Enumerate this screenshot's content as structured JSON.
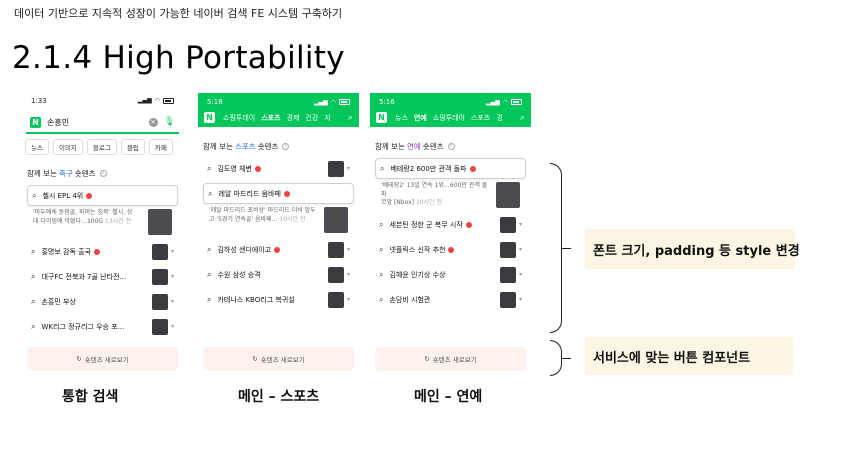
{
  "slide": {
    "header": "데이터 기반으로 지속적 성장이 가능한 네이버 검색 FE 시스템 구축하기",
    "title": "2.1.4 High Portability"
  },
  "colors": {
    "naver_green": "#03c75a",
    "sport_blue": "#1a73e8",
    "ent_purple": "#a23bc4",
    "note_bg": "#fdf5e4",
    "button_bg": "#fdf1ee"
  },
  "phone1": {
    "time": "1:33",
    "query": "손흥민",
    "tabs": [
      "뉴스",
      "이미지",
      "블로그",
      "클립",
      "카페"
    ],
    "section_prefix": "함께 보는 ",
    "section_highlight": "축구",
    "section_suffix": " 숏텐츠",
    "items": [
      "첼시 EPL 4위",
      "홍명보 감독 출국",
      "대구FC 전북과 7골 난타전...",
      "손흥민 부상",
      "WK리그 정규리그 우승 포..."
    ],
    "snippet_line1": "'마두에케 동점골, 파머는 침묵' 첼시, 상",
    "snippet_line2": "대 다이빙에 막혔다…100G",
    "snippet_ago": "13시간 전",
    "more_label": "숏텐츠 새로보기"
  },
  "phone2": {
    "time": "5:18",
    "nav": [
      "쇼핑투데이",
      "스포츠",
      "경제",
      "건강",
      "지"
    ],
    "section_prefix": "함께 보는 ",
    "section_highlight": "스포츠",
    "section_suffix": " 숏텐츠",
    "items": [
      "김도영 체변",
      "레알 마드리드 음바페",
      "김하성 샌디에이고",
      "수원 삼성 승격",
      "카테나스 KBO리그 복귀설"
    ],
    "snippet_line1": "'레알 마드리드 초비상' 마드리드 더비 앞두",
    "snippet_line2": "고 '5경기 연속골' 음바페…",
    "snippet_ago": "10시간 전",
    "more_label": "숏텐츠 새로보기"
  },
  "phone3": {
    "time": "5:16",
    "nav": [
      "뉴스",
      "연예",
      "쇼핑투데이",
      "스포츠",
      "경"
    ],
    "section_prefix": "함께 보는 ",
    "section_highlight": "연예",
    "section_suffix": " 숏텐츠",
    "items": [
      "베테랑2 600만 관객 돌파",
      "세븐틴 정한 군 복무 시작",
      "넷플릭스 신작 추천",
      "김혜윤 인기상 수상",
      "손담비 시험관"
    ],
    "snippet_line1": "'베테랑2' 13일 연속 1위…600만 관객 돌파",
    "snippet_line2": "코앞 [Nbox]",
    "snippet_ago": "10시간 전",
    "more_label": "숏텐츠 새로보기"
  },
  "captions": [
    "통합 검색",
    "메인 – 스포츠",
    "메인 – 연예"
  ],
  "notes": {
    "style_change": "폰트 크기, padding 등 style 변경",
    "button_component": "서비스에 맞는 버튼 컴포넌트"
  }
}
